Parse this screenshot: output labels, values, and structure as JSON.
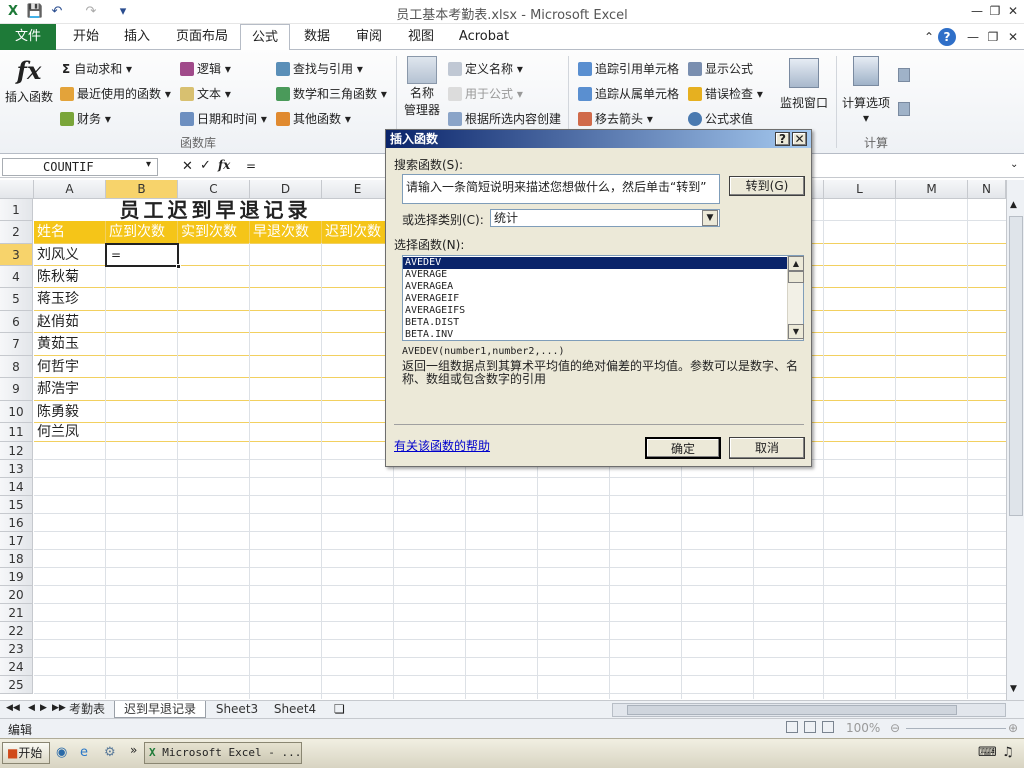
{
  "window": {
    "title": "员工基本考勤表.xlsx - Microsoft Excel"
  },
  "tabs": [
    "文件",
    "开始",
    "插入",
    "页面布局",
    "公式",
    "数据",
    "审阅",
    "视图",
    "Acrobat"
  ],
  "ribbon": {
    "insert_function": "插入函数",
    "autosum": "自动求和",
    "recent": "最近使用的函数",
    "finance": "财务",
    "logic": "逻辑",
    "text": "文本",
    "datetime": "日期和时间",
    "lookup": "查找与引用",
    "math": "数学和三角函数",
    "other": "其他函数",
    "group_library": "函数库",
    "name_mgr_1": "名称",
    "name_mgr_2": "管理器",
    "define_name": "定义名称",
    "use_in_formula": "用于公式",
    "create_from_sel": "根据所选内容创建",
    "trace_precedents": "追踪引用单元格",
    "trace_dependents": "追踪从属单元格",
    "remove_arrows": "移去箭头",
    "show_formulas": "显示公式",
    "error_check": "错误检查",
    "eval_formula": "公式求值",
    "watch_window": "监视窗口",
    "calc_options": "计算选项",
    "group_calc": "计算"
  },
  "formula_bar": {
    "name_box": "COUNTIF",
    "fx": "fx",
    "value": "="
  },
  "sheet": {
    "columns": [
      "A",
      "B",
      "C",
      "D",
      "E",
      "L",
      "M",
      "N"
    ],
    "rows": [
      "1",
      "2",
      "3",
      "4",
      "5",
      "6",
      "7",
      "8",
      "9",
      "10",
      "11",
      "12",
      "13",
      "14",
      "15",
      "16",
      "17",
      "18",
      "19",
      "20",
      "21",
      "22",
      "23",
      "24",
      "25"
    ],
    "title": "员工迟到早退记录",
    "headers": [
      "姓名",
      "应到次数",
      "实到次数",
      "早退次数",
      "迟到次数"
    ],
    "names": [
      "刘风义",
      "陈秋菊",
      "蒋玉珍",
      "赵俏茹",
      "黄茹玉",
      "何哲宇",
      "郝浩宇",
      "陈勇毅",
      "何兰凤"
    ],
    "active_value": "="
  },
  "dialog": {
    "title": "插入函数",
    "search_label": "搜索函数(S):",
    "search_value": "请输入一条简短说明来描述您想做什么，然后单击“转到”",
    "go_button": "转到(G)",
    "category_label": "或选择类别(C):",
    "category_value": "统计",
    "function_label": "选择函数(N):",
    "functions": [
      "AVEDEV",
      "AVERAGE",
      "AVERAGEA",
      "AVERAGEIF",
      "AVERAGEIFS",
      "BETA.DIST",
      "BETA.INV"
    ],
    "signature": "AVEDEV(number1,number2,...)",
    "description": "返回一组数据点到其算术平均值的绝对偏差的平均值。参数可以是数字、名称、数组或包含数字的引用",
    "help_link": "有关该函数的帮助",
    "ok": "确定",
    "cancel": "取消"
  },
  "sheet_tabs": [
    "考勤表",
    "迟到早退记录",
    "Sheet3",
    "Sheet4"
  ],
  "status": {
    "mode": "编辑",
    "zoom": "100%"
  },
  "taskbar": {
    "start": "开始",
    "app": "Microsoft Excel - ..."
  },
  "colors": {
    "file_tab": "#1e7a38",
    "header_fill": "#f5c518",
    "grid_border": "#f2d060"
  }
}
